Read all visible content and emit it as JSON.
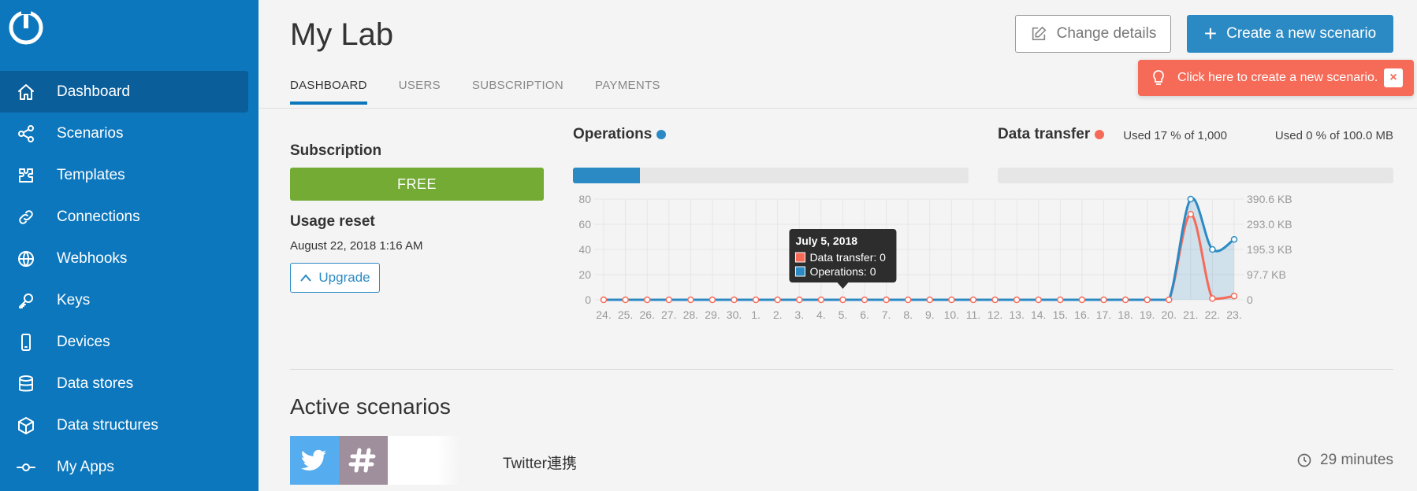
{
  "sidebar": {
    "items": [
      {
        "label": "Dashboard",
        "icon": "home-icon",
        "active": true
      },
      {
        "label": "Scenarios",
        "icon": "share-icon"
      },
      {
        "label": "Templates",
        "icon": "puzzle-icon"
      },
      {
        "label": "Connections",
        "icon": "link-icon"
      },
      {
        "label": "Webhooks",
        "icon": "globe-icon"
      },
      {
        "label": "Keys",
        "icon": "key-icon"
      },
      {
        "label": "Devices",
        "icon": "phone-icon"
      },
      {
        "label": "Data stores",
        "icon": "database-icon"
      },
      {
        "label": "Data structures",
        "icon": "cube-icon"
      },
      {
        "label": "My Apps",
        "icon": "commit-icon"
      }
    ]
  },
  "header": {
    "title": "My Lab",
    "tabs": [
      "DASHBOARD",
      "USERS",
      "SUBSCRIPTION",
      "PAYMENTS"
    ],
    "change_details": "Change details",
    "create_scenario": "Create a new scenario",
    "toast": "Click here to create a new scenario.",
    "toast_close": "×"
  },
  "subscription": {
    "title": "Subscription",
    "plan": "FREE",
    "reset_title": "Usage reset",
    "reset_date": "August 22, 2018 1:16 AM",
    "upgrade": "Upgrade"
  },
  "operations": {
    "title": "Operations",
    "used": "Used 17 % of 1,000",
    "fraction": 0.17,
    "color": "#2b8ac4"
  },
  "data_transfer": {
    "title": "Data transfer",
    "used": "Used 0 % of 100.0 MB",
    "fraction": 0,
    "color": "#f66a58"
  },
  "chart_data": {
    "type": "line",
    "x": [
      "24.",
      "25.",
      "26.",
      "27.",
      "28.",
      "29.",
      "30.",
      "1.",
      "2.",
      "3.",
      "4.",
      "5.",
      "6.",
      "7.",
      "8.",
      "9.",
      "10.",
      "11.",
      "12.",
      "13.",
      "14.",
      "15.",
      "16.",
      "17.",
      "18.",
      "19.",
      "20.",
      "21.",
      "22.",
      "23."
    ],
    "yticks_left": [
      "0",
      "20",
      "40",
      "60",
      "80"
    ],
    "yticks_right": [
      "0",
      "97.7 KB",
      "195.3 KB",
      "293.0 KB",
      "390.6 KB"
    ],
    "ylim": [
      0,
      80
    ],
    "series": [
      {
        "name": "Operations",
        "color": "#2b8ac4",
        "values": [
          0,
          0,
          0,
          0,
          0,
          0,
          0,
          0,
          0,
          0,
          0,
          0,
          0,
          0,
          0,
          0,
          0,
          0,
          0,
          0,
          0,
          0,
          0,
          0,
          0,
          0,
          0,
          80,
          40,
          48
        ]
      },
      {
        "name": "Data transfer",
        "color": "#f66a58",
        "values": [
          0,
          0,
          0,
          0,
          0,
          0,
          0,
          0,
          0,
          0,
          0,
          0,
          0,
          0,
          0,
          0,
          0,
          0,
          0,
          0,
          0,
          0,
          0,
          0,
          0,
          0,
          0,
          68,
          1,
          3
        ]
      }
    ],
    "tooltip": {
      "index": 11,
      "title": "July 5, 2018",
      "lines": [
        "Data transfer: 0",
        "Operations: 0"
      ]
    }
  },
  "active_scenarios": {
    "title": "Active scenarios",
    "items": [
      {
        "name": "Twitter連携",
        "time": "29 minutes",
        "apps": [
          "twitter-icon",
          "slack-icon"
        ]
      }
    ]
  }
}
